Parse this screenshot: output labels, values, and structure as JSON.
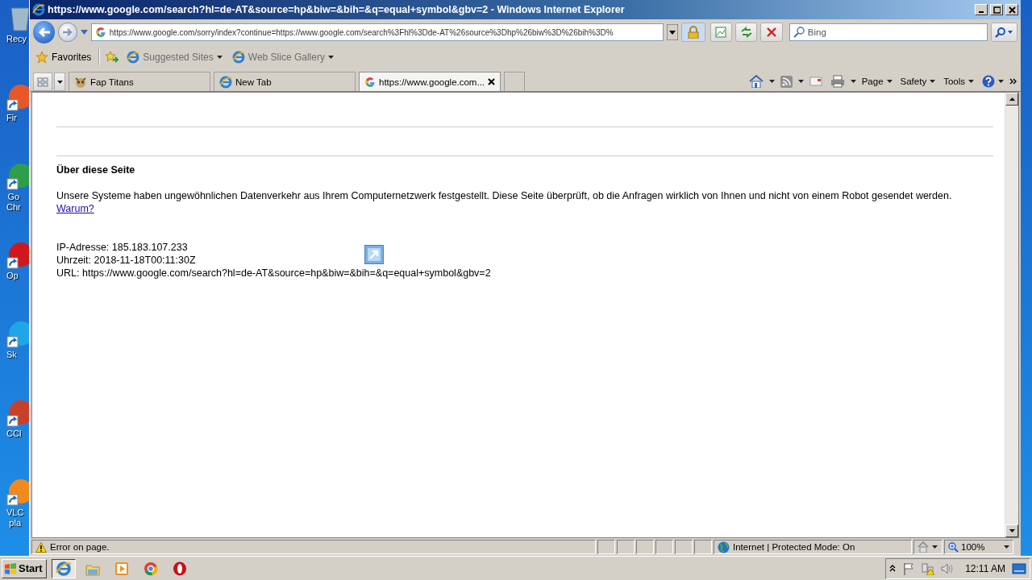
{
  "desktop": {
    "icons": [
      {
        "lines": [
          "Recy"
        ],
        "color": "#9fb8cc"
      },
      {
        "lines": [
          "Fir"
        ],
        "color": "#e8572a"
      },
      {
        "lines": [
          "Go",
          "Chr"
        ],
        "color": "#2e9e4a"
      },
      {
        "lines": [
          "Op"
        ],
        "color": "#d0181c"
      },
      {
        "lines": [
          "Sk"
        ],
        "color": "#1ea7e8"
      },
      {
        "lines": [
          "CCl"
        ],
        "color": "#c8402a"
      },
      {
        "lines": [
          "VLC",
          "pla"
        ],
        "color": "#f08a1c"
      }
    ]
  },
  "window": {
    "title": "https://www.google.com/search?hl=de-AT&source=hp&biw=&bih=&q=equal+symbol&gbv=2 - Windows Internet Explorer"
  },
  "address_bar": {
    "value": "https://www.google.com/sorry/index?continue=https://www.google.com/search%3Fhl%3Dde-AT%26source%3Dhp%26biw%3D%26bih%3D%"
  },
  "search": {
    "placeholder": "Bing"
  },
  "favorites_bar": {
    "label": "Favorites",
    "links": [
      "Suggested Sites",
      "Web Slice Gallery"
    ]
  },
  "tabs": [
    {
      "label": "Fap Titans",
      "kind": "game",
      "selected": false
    },
    {
      "label": "New Tab",
      "kind": "ie",
      "selected": false
    },
    {
      "label": "https://www.google.com...",
      "kind": "google",
      "selected": true
    }
  ],
  "command_bar": [
    "Page",
    "Safety",
    "Tools"
  ],
  "content": {
    "heading": "Über diese Seite",
    "message": "Unsere Systeme haben ungewöhnlichen Datenverkehr aus Ihrem Computernetzwerk festgestellt. Diese Seite überprüft, ob die Anfragen wirklich von Ihnen und nicht von einem Robot gesendet werden.",
    "link": "Warum?",
    "details": [
      "IP-Adresse: 185.183.107.233",
      "Uhrzeit: 2018-11-18T00:11:30Z",
      "URL: https://www.google.com/search?hl=de-AT&source=hp&biw=&bih=&q=equal+symbol&gbv=2"
    ]
  },
  "status_bar": {
    "message": "Error on page.",
    "zone": "Internet | Protected Mode: On",
    "zoom": "100%"
  },
  "taskbar": {
    "start": "Start",
    "clock": "12:11 AM"
  }
}
